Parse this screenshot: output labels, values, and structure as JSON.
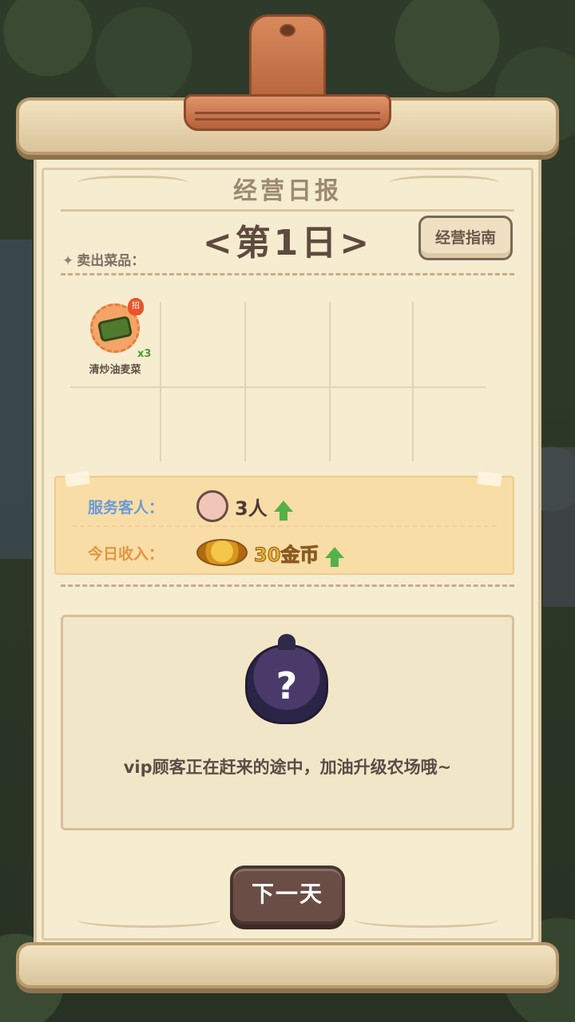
{
  "report": {
    "title": "经营日报",
    "day_label": "<第1日>",
    "guide_button": "经营指南",
    "sold_label": "卖出菜品："
  },
  "dishes": [
    {
      "name": "清炒油麦菜",
      "count": "x3",
      "badge": "招"
    }
  ],
  "stats": {
    "guests_label": "服务客人：",
    "guests_value": "3人",
    "income_label": "今日收入：",
    "income_value": "30金币"
  },
  "vip": {
    "icon_text": "?",
    "message": "vip顾客正在赶来的途中，加油升级农场哦~"
  },
  "actions": {
    "next_day": "下一天"
  }
}
